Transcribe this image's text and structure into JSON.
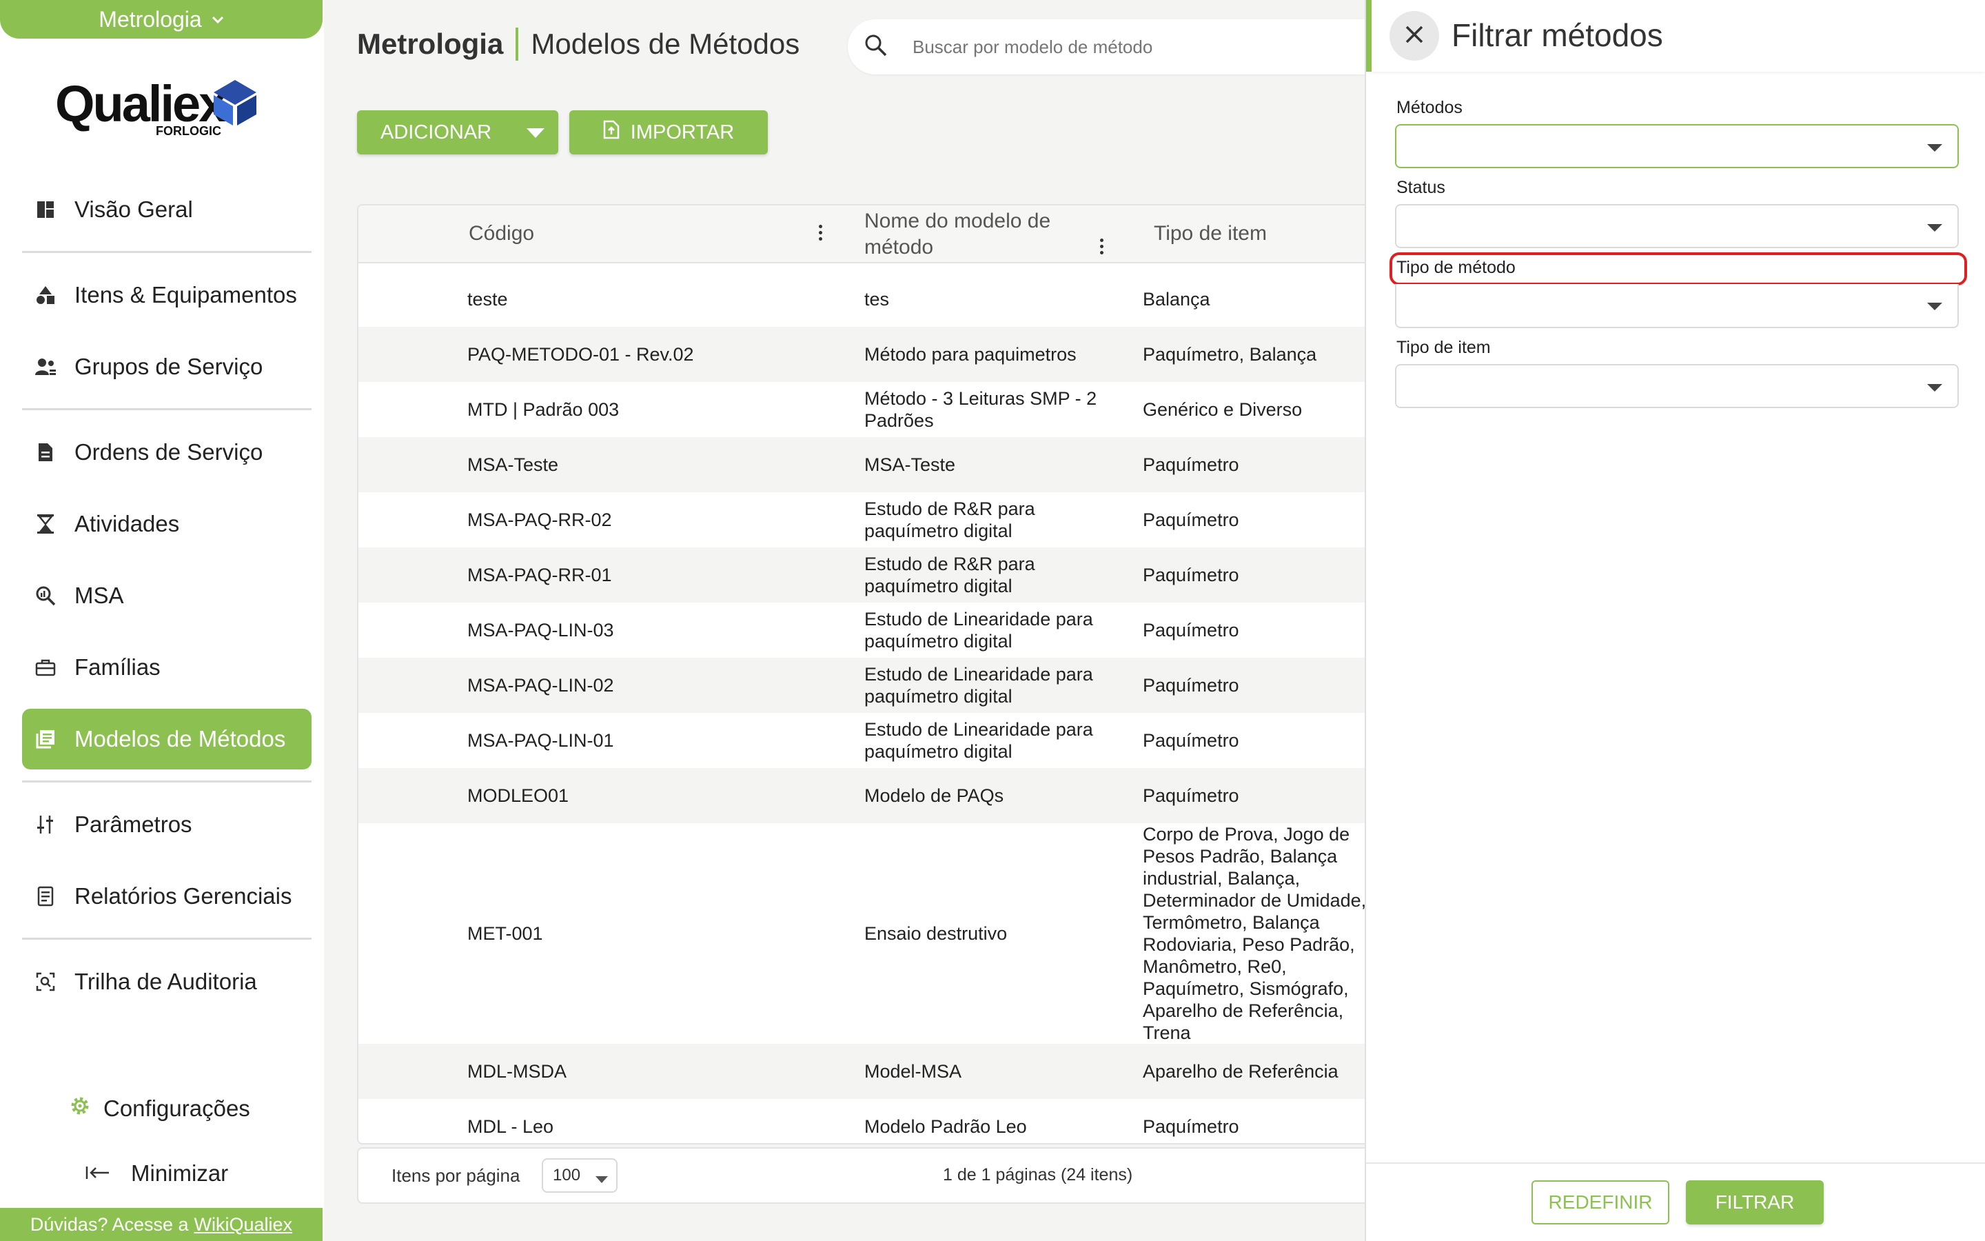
{
  "sidebar": {
    "module": "Metrologia",
    "logo_word": "Qualiex",
    "logo_sub": "FORLOGIC",
    "items": [
      {
        "label": "Visão Geral",
        "icon": "dashboard-icon"
      },
      {
        "label": "Itens & Equipamentos",
        "icon": "shapes-icon"
      },
      {
        "label": "Grupos de Serviço",
        "icon": "group-icon"
      },
      {
        "label": "Ordens de Serviço",
        "icon": "document-icon"
      },
      {
        "label": "Atividades",
        "icon": "hourglass-icon"
      },
      {
        "label": "MSA",
        "icon": "zoom-analytics-icon"
      },
      {
        "label": "Famílias",
        "icon": "toolbox-icon"
      },
      {
        "label": "Modelos de Métodos",
        "icon": "library-icon"
      },
      {
        "label": "Parâmetros",
        "icon": "sliders-icon"
      },
      {
        "label": "Relatórios Gerenciais",
        "icon": "report-icon"
      },
      {
        "label": "Trilha de Auditoria",
        "icon": "audit-icon"
      }
    ],
    "active_index": 7,
    "config_label": "Configurações",
    "minimize_label": "Minimizar",
    "help_text": "Dúvidas? Acesse a",
    "help_link": "WikiQualiex"
  },
  "header": {
    "module": "Metrologia",
    "page": "Modelos de Métodos",
    "search_placeholder": "Buscar por modelo de método"
  },
  "toolbar": {
    "add_label": "ADICIONAR",
    "import_label": "IMPORTAR"
  },
  "table": {
    "columns": [
      "Código",
      "Nome do modelo de método",
      "Tipo de item"
    ],
    "rows": [
      {
        "code": "teste",
        "name": "tes",
        "type": "Balança"
      },
      {
        "code": "PAQ-METODO-01 - Rev.02",
        "name": "Método para paquimetros",
        "type": "Paquímetro, Balança"
      },
      {
        "code": "MTD | Padrão 003",
        "name": "Método - 3 Leituras SMP - 2 Padrões",
        "type": "Genérico e Diverso"
      },
      {
        "code": "MSA-Teste",
        "name": "MSA-Teste",
        "type": "Paquímetro"
      },
      {
        "code": "MSA-PAQ-RR-02",
        "name": "Estudo de R&R para paquímetro digital",
        "type": "Paquímetro"
      },
      {
        "code": "MSA-PAQ-RR-01",
        "name": "Estudo de R&R para paquímetro digital",
        "type": "Paquímetro"
      },
      {
        "code": "MSA-PAQ-LIN-03",
        "name": "Estudo de Linearidade para paquímetro digital",
        "type": "Paquímetro"
      },
      {
        "code": "MSA-PAQ-LIN-02",
        "name": "Estudo de Linearidade para paquímetro digital",
        "type": "Paquímetro"
      },
      {
        "code": "MSA-PAQ-LIN-01",
        "name": "Estudo de Linearidade para paquímetro digital",
        "type": "Paquímetro"
      },
      {
        "code": "MODLEO01",
        "name": "Modelo de PAQs",
        "type": "Paquímetro"
      },
      {
        "code": "MET-001",
        "name": "Ensaio destrutivo",
        "type": "Corpo de Prova, Jogo de Pesos Padrão, Balança industrial, Balança, Determinador de Umidade, Termômetro, Balança Rodoviaria, Peso Padrão, Manômetro, Re0, Paquímetro, Sismógrafo, Aparelho de Referência, Trena"
      },
      {
        "code": "MDL-MSDA",
        "name": "Model-MSA",
        "type": "Aparelho de Referência"
      },
      {
        "code": "MDL - Leo",
        "name": "Modelo Padrão Leo",
        "type": "Paquímetro"
      }
    ]
  },
  "pager": {
    "per_page_label": "Itens por página",
    "per_page_value": "100",
    "info": "1 de 1 páginas (24 itens)"
  },
  "filter": {
    "title": "Filtrar métodos",
    "fields": [
      {
        "label": "Métodos",
        "value": ""
      },
      {
        "label": "Status",
        "value": ""
      },
      {
        "label": "Tipo de método",
        "value": ""
      },
      {
        "label": "Tipo de item",
        "value": ""
      }
    ],
    "reset_label": "REDEFINIR",
    "apply_label": "FILTRAR"
  },
  "colors": {
    "accent": "#8cc152",
    "highlight": "#e02020"
  }
}
